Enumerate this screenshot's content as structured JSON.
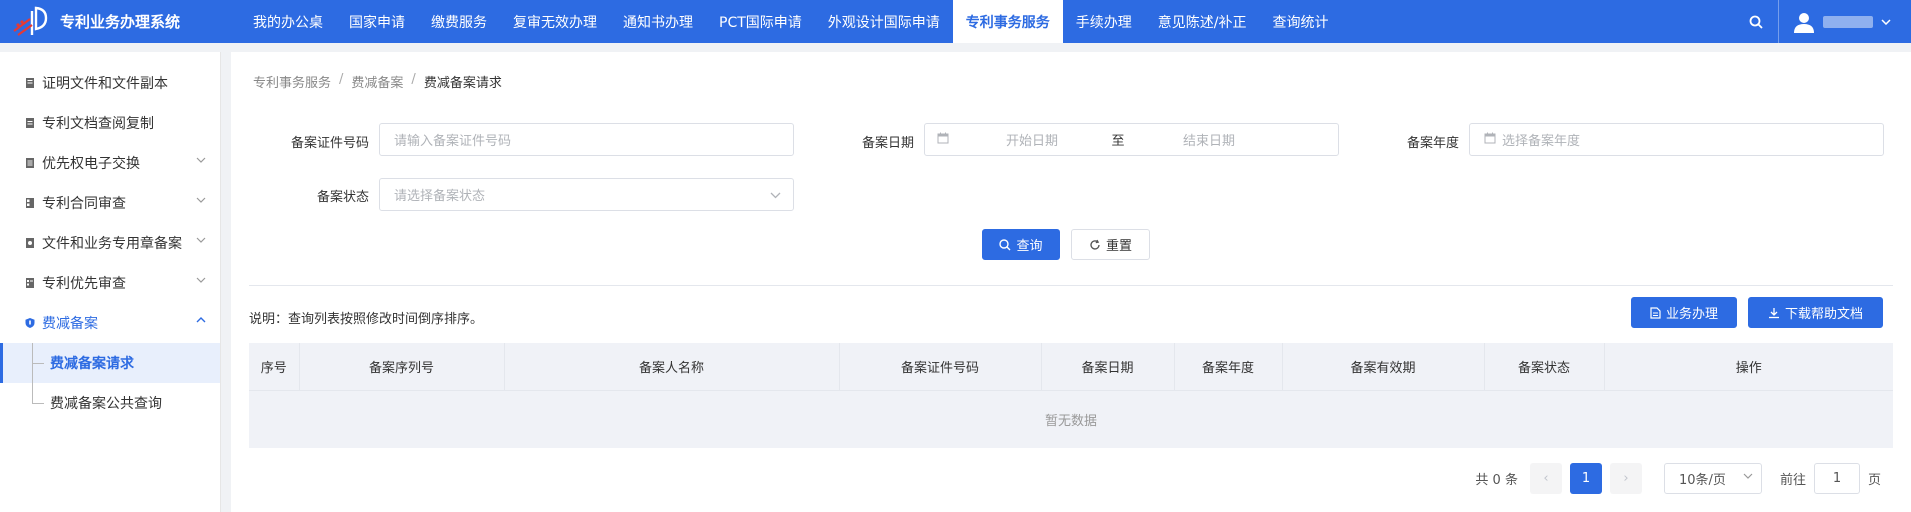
{
  "app": {
    "title": "专利业务办理系统"
  },
  "nav": {
    "items": [
      {
        "label": "我的办公桌"
      },
      {
        "label": "国家申请"
      },
      {
        "label": "缴费服务"
      },
      {
        "label": "复审无效办理"
      },
      {
        "label": "通知书办理"
      },
      {
        "label": "PCT国际申请"
      },
      {
        "label": "外观设计国际申请"
      },
      {
        "label": "专利事务服务"
      },
      {
        "label": "手续办理"
      },
      {
        "label": "意见陈述/补正"
      },
      {
        "label": "查询统计"
      }
    ],
    "active_index": 7
  },
  "sidebar": {
    "items": [
      {
        "label": "证明文件和文件副本"
      },
      {
        "label": "专利文档查阅复制"
      },
      {
        "label": "优先权电子交换"
      },
      {
        "label": "专利合同审查"
      },
      {
        "label": "文件和业务专用章备案"
      },
      {
        "label": "专利优先审查"
      },
      {
        "label": "费减备案"
      }
    ],
    "sub_items": [
      {
        "label": "费减备案请求"
      },
      {
        "label": "费减备案公共查询"
      }
    ]
  },
  "breadcrumb": {
    "l1": "专利事务服务",
    "l2": "费减备案",
    "current": "费减备案请求",
    "sep": "/"
  },
  "form": {
    "cert_label": "备案证件号码",
    "cert_placeholder": "请输入备案证件号码",
    "date_label": "备案日期",
    "date_start": "开始日期",
    "date_to": "至",
    "date_end": "结束日期",
    "year_label": "备案年度",
    "year_placeholder": "选择备案年度",
    "status_label": "备案状态",
    "status_placeholder": "请选择备案状态",
    "query_btn": "查询",
    "reset_btn": "重置"
  },
  "note": "说明：查询列表按照修改时间倒序排序。",
  "actions": {
    "handle_btn": "业务办理",
    "download_btn": "下载帮助文档"
  },
  "table": {
    "columns": [
      "序号",
      "备案序列号",
      "备案人名称",
      "备案证件号码",
      "备案日期",
      "备案年度",
      "备案有效期",
      "备案状态",
      "操作"
    ],
    "empty_text": "暂无数据"
  },
  "pager": {
    "total": "共 0 条",
    "prev": "‹",
    "current": "1",
    "next": "›",
    "page_size": "10条/页",
    "goto_prefix": "前往",
    "goto_value": "1",
    "goto_suffix": "页"
  },
  "colors": {
    "primary": "#2d6be2",
    "header_bg": "#2d6be2",
    "table_head": "#f0f2f7"
  }
}
